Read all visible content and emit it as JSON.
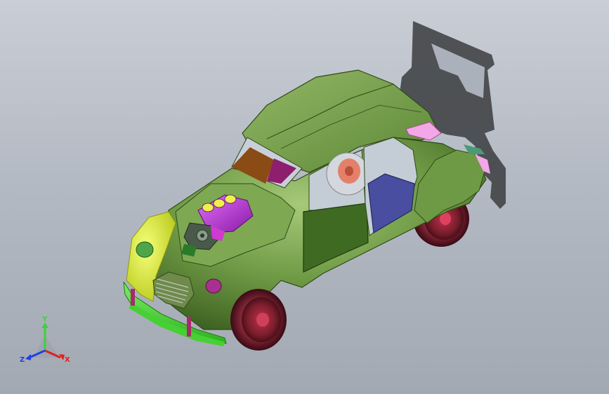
{
  "viewport": {
    "background_top": "#c9ced6",
    "background_bottom": "#a3a9b3"
  },
  "model": {
    "body_color": "#6f9a45",
    "fender_color": "#e2ef2f",
    "bumper_color": "#5ee34a",
    "engine_color": "#b82fd6",
    "wheel_color": "#7a1e2c",
    "door_blue": "#4a4ea0",
    "door_green": "#3f6a22",
    "window_orange": "#8a4b14",
    "trim_pink": "#f3a6e8"
  },
  "triad": {
    "y_label": "Y",
    "x_label": "X",
    "z_label": "Z",
    "y_color": "#3dd13d",
    "x_color": "#e02020",
    "z_color": "#2040e0"
  }
}
